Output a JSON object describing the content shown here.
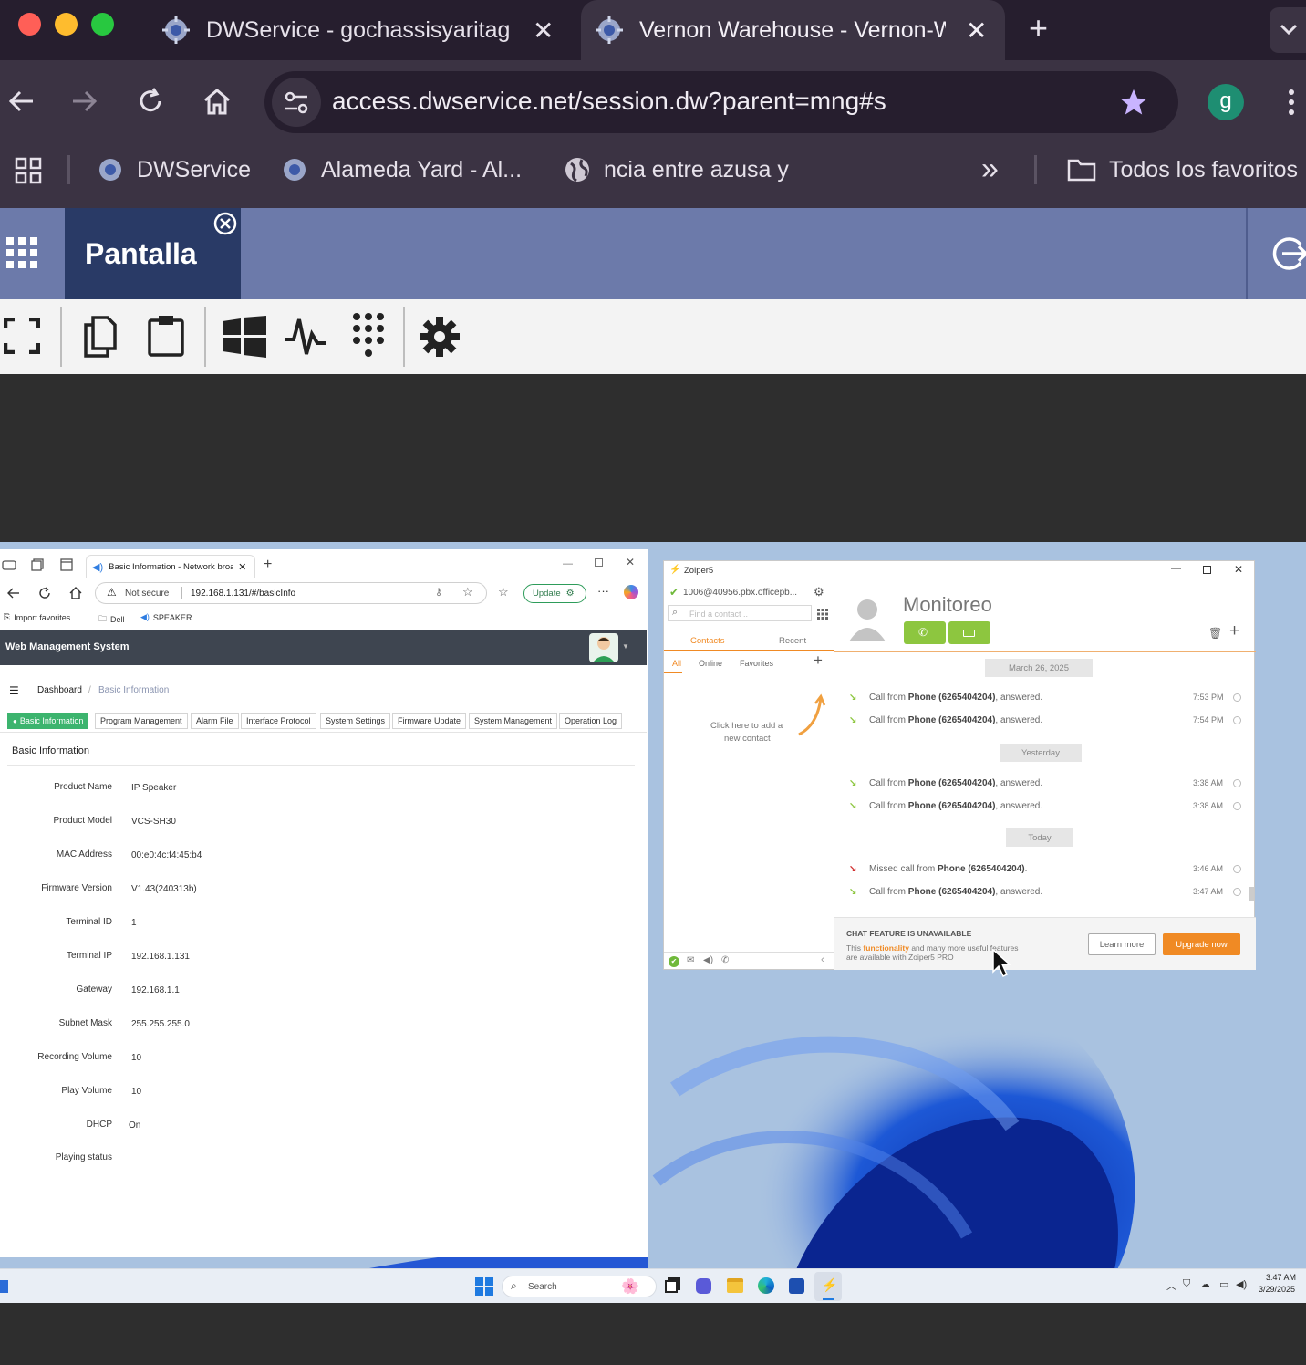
{
  "browser": {
    "tabs": [
      {
        "title": "DWService - gochassisyaritag",
        "active": false
      },
      {
        "title": "Vernon Warehouse - Vernon-W",
        "active": true
      }
    ],
    "new_tab": "+",
    "url": "access.dwservice.net/session.dw?parent=mng#s",
    "profile_initial": "g",
    "bookmarks": [
      "DWService",
      "Alameda Yard - Al...",
      "ncia entre azusa y"
    ],
    "more_bookmarks": "»",
    "all_bookmarks": "Todos los favoritos"
  },
  "dwservice": {
    "tab_label": "Pantalla"
  },
  "edge": {
    "tab_title": "Basic Information - Network broa",
    "not_secure": "Not secure",
    "url": "192.168.1.131/#/basicInfo",
    "update": "Update",
    "fav_bar": [
      "Import favorites",
      "Dell",
      "SPEAKER"
    ],
    "app_title": "Web Management System",
    "breadcrumb": {
      "home": "Dashboard",
      "sep": "/",
      "current": "Basic Information"
    },
    "subtabs": [
      "Basic Information",
      "Program Management",
      "Alarm File",
      "Interface Protocol",
      "System Settings",
      "Firmware Update",
      "System Management",
      "Operation Log"
    ],
    "section_title": "Basic Information",
    "fields": [
      {
        "label": "Product Name",
        "value": "IP Speaker"
      },
      {
        "label": "Product Model",
        "value": "VCS-SH30"
      },
      {
        "label": "MAC Address",
        "value": "00:e0:4c:f4:45:b4"
      },
      {
        "label": "Firmware Version",
        "value": "V1.43(240313b)"
      },
      {
        "label": "Terminal ID",
        "value": "1"
      },
      {
        "label": "Terminal IP",
        "value": "192.168.1.131"
      },
      {
        "label": "Gateway",
        "value": "192.168.1.1"
      },
      {
        "label": "Subnet Mask",
        "value": "255.255.255.0"
      },
      {
        "label": "Recording Volume",
        "value": "10"
      },
      {
        "label": "Play Volume",
        "value": "10"
      },
      {
        "label": "DHCP",
        "value": "On"
      },
      {
        "label": "Playing status",
        "value": ""
      }
    ]
  },
  "zoiper": {
    "title": "Zoiper5",
    "account": "1006@40956.pbx.officepb...",
    "search_placeholder": "Find a contact ..",
    "tabs": [
      "Contacts",
      "Recent"
    ],
    "filters": [
      "All",
      "Online",
      "Favorites"
    ],
    "empty_hint_1": "Click here to add a",
    "empty_hint_2": "new contact",
    "contact_name": "Monitoreo",
    "days": [
      "March 26, 2025",
      "Yesterday",
      "Today"
    ],
    "calls": [
      {
        "prefix": "Call from ",
        "who": "Phone (6265404204)",
        "suffix": ", answered.",
        "time": "7:53 PM",
        "missed": false
      },
      {
        "prefix": "Call from ",
        "who": "Phone (6265404204)",
        "suffix": ", answered.",
        "time": "7:54 PM",
        "missed": false
      },
      {
        "prefix": "Call from ",
        "who": "Phone (6265404204)",
        "suffix": ", answered.",
        "time": "3:38 AM",
        "missed": false
      },
      {
        "prefix": "Call from ",
        "who": "Phone (6265404204)",
        "suffix": ", answered.",
        "time": "3:38 AM",
        "missed": false
      },
      {
        "prefix": "Missed call from ",
        "who": "Phone (6265404204)",
        "suffix": ".",
        "time": "3:46 AM",
        "missed": true
      },
      {
        "prefix": "Call from ",
        "who": "Phone (6265404204)",
        "suffix": ", answered.",
        "time": "3:47 AM",
        "missed": false
      }
    ],
    "chat_unavailable": "CHAT FEATURE IS UNAVAILABLE",
    "promo_1": "This ",
    "promo_link": "functionality",
    "promo_2": " and many more useful features",
    "promo_3": "are available with Zoiper5 PRO",
    "learn_more": "Learn more",
    "upgrade": "Upgrade now"
  },
  "taskbar": {
    "search": "Search",
    "time": "3:47 AM",
    "date": "3/29/2025"
  },
  "colors": {
    "tabbar_bg": "#261e2e",
    "toolbar_bg": "#3b3343",
    "dw_bar": "#6c7aaa",
    "dw_active_tab": "#293a66",
    "edge_green": "#3cb46e",
    "zoiper_green": "#8dc63f",
    "zoiper_orange": "#f08a24"
  }
}
